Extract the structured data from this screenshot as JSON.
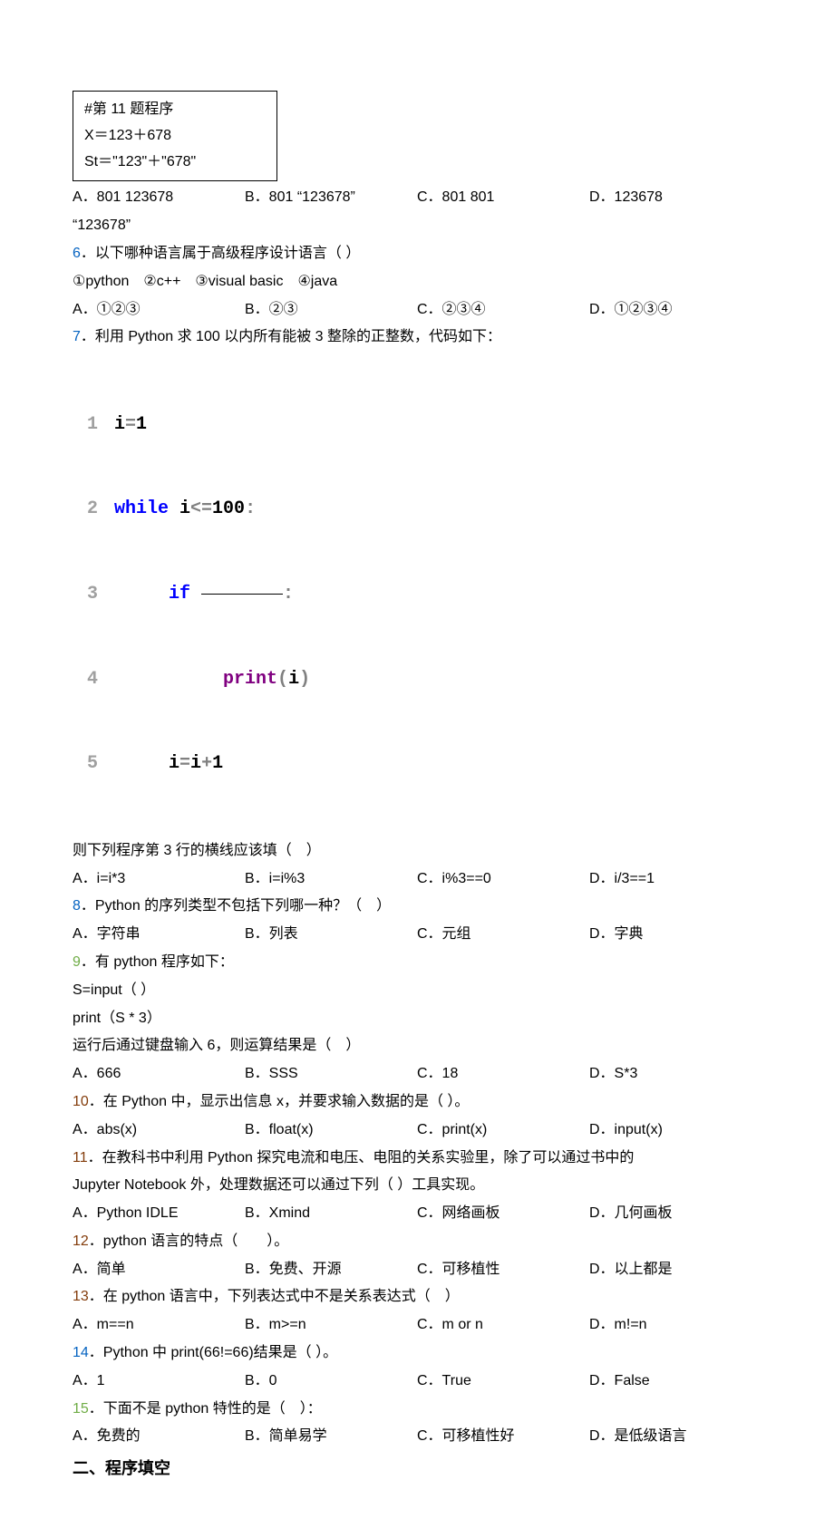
{
  "codebox": {
    "l1": "#第 11 题程序",
    "l2": "X＝123＋678",
    "l3": "St＝\"123\"＋\"678\""
  },
  "q5": {
    "a": "A．801 123678",
    "b": "B．801 “123678”",
    "c": "C．801 801",
    "d": "D．123678",
    "d2": "“123678”"
  },
  "q6": {
    "num": "6",
    "text": "．以下哪种语言属于高级程序设计语言（ ）",
    "sub": "①python　②c++　③visual basic　④java",
    "a": "A．①②③",
    "b": "B．②③",
    "c": "C．②③④",
    "d": "D．①②③④"
  },
  "q7": {
    "num": "7",
    "text": "．利用 Python 求 100 以内所有能被 3 整除的正整数，代码如下：",
    "after": "则下列程序第 3 行的横线应该填（　）",
    "a": "A．i=i*3",
    "b": "B．i=i%3",
    "c": "C．i%3==0",
    "d": "D．i/3==1"
  },
  "code": {
    "l1a": "i",
    "l1b": "=",
    "l1c": "1",
    "l2a": "while",
    "l2b": " i",
    "l2c": "<=",
    "l2d": "100",
    "l2e": ":",
    "l3a": "if",
    "l3b": ":",
    "l4a": "print",
    "l4b": "(",
    "l4c": "i",
    "l4d": ")",
    "l5a": "i",
    "l5b": "=",
    "l5c": "i",
    "l5d": "+",
    "l5e": "1"
  },
  "q8": {
    "num": "8",
    "text": "．Python 的序列类型不包括下列哪一种？（　）",
    "a": "A．字符串",
    "b": "B．列表",
    "c": "C．元组",
    "d": "D．字典"
  },
  "q9": {
    "num": "9",
    "text": "．有 python 程序如下：",
    "l1": "S=input（ ）",
    "l2": "print（S * 3）",
    "after": "运行后通过键盘输入 6，则运算结果是（　）",
    "a": "A．666",
    "b": "B．SSS",
    "c": "C．18",
    "d": "D．S*3"
  },
  "q10": {
    "num": "10",
    "text": "．在 Python 中，显示出信息 x，并要求输入数据的是（ ）。",
    "a": "A．abs(x)",
    "b": "B．float(x)",
    "c": "C．print(x)",
    "d": "D．input(x)"
  },
  "q11": {
    "num": "11",
    "text": "．在教科书中利用 Python 探究电流和电压、电阻的关系实验里，除了可以通过书中的",
    "text2": "Jupyter Notebook 外，处理数据还可以通过下列（ ）工具实现。",
    "a": "A．Python IDLE",
    "b": "B．Xmind",
    "c": "C．网络画板",
    "d": "D．几何画板"
  },
  "q12": {
    "num": "12",
    "text": "．python 语言的特点（　　）。",
    "a": "A．简单",
    "b": "B．免费、开源",
    "c": "C．可移植性",
    "d": "D．以上都是"
  },
  "q13": {
    "num": "13",
    "text": "．在 python 语言中，下列表达式中不是关系表达式（　）",
    "a": "A．m==n",
    "b": "B．m>=n",
    "c": "C．m  or  n",
    "d": "D．m!=n"
  },
  "q14": {
    "num": "14",
    "text": "．Python 中 print(66!=66)结果是（ ）。",
    "a": "A．1",
    "b": "B．0",
    "c": "C．True",
    "d": "D．False"
  },
  "q15": {
    "num": "15",
    "text": "．下面不是 python 特性的是（　）：",
    "a": "A．免费的",
    "b": "B．简单易学",
    "c": "C．可移植性好",
    "d": "D．是低级语言"
  },
  "section2": "二、程序填空"
}
